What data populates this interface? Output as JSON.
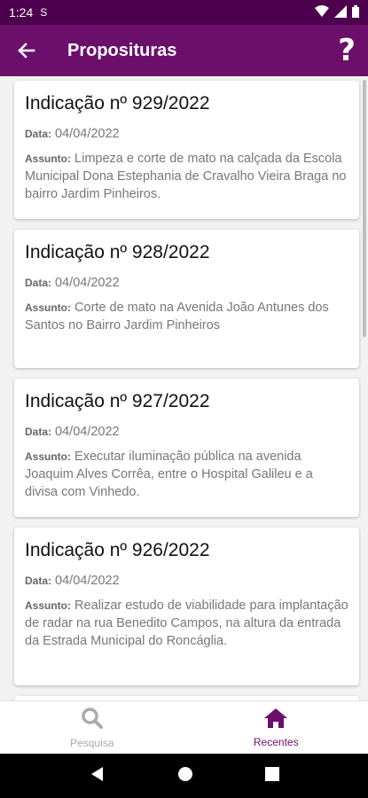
{
  "status_bar": {
    "time": "1:24",
    "sync_glyph": "S"
  },
  "app_bar": {
    "title": "Proposituras",
    "help_glyph": "?"
  },
  "labels": {
    "date": "Data:",
    "subject": "Assunto:"
  },
  "cards": [
    {
      "title": "Indicação nº 929/2022",
      "date": "04/04/2022",
      "subject": "Limpeza e corte de mato na calçada da Escola Municipal Dona Estephania de Cravalho Vieira Braga  no bairro Jardim Pinheiros."
    },
    {
      "title": "Indicação nº 928/2022",
      "date": "04/04/2022",
      "subject": "Corte de mato na Avenida João Antunes dos Santos no Bairro Jardim Pinheiros"
    },
    {
      "title": "Indicação nº 927/2022",
      "date": "04/04/2022",
      "subject": "Executar iluminação pública na avenida Joaquim Alves Corrêa, entre o Hospital Galileu e a divisa com Vinhedo."
    },
    {
      "title": "Indicação nº 926/2022",
      "date": "04/04/2022",
      "subject": "Realizar estudo de viabilidade para implantação de radar na rua Benedito Campos, na altura da entrada da Estrada Municipal do Roncáglia."
    }
  ],
  "bottom_nav": {
    "search_label": "Pesquisa",
    "recent_label": "Recentes",
    "active": "Recentes"
  },
  "colors": {
    "primary": "#6b0f6b",
    "status_bar": "#4d004d",
    "inactive": "#aaaaaa"
  }
}
